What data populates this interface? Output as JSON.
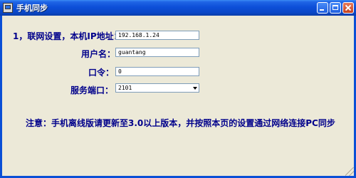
{
  "window": {
    "title": "手机同步"
  },
  "form": {
    "step_label": "1，联网设置，本机IP地址：",
    "ip_value": "192.168.1.24",
    "username_label": "用户名：",
    "username_value": "guantang",
    "password_label": "口令：",
    "password_value": "0",
    "port_label": "服务端口：",
    "port_value": "2101"
  },
  "notice": "注意：手机离线版请更新至3.0以上版本，并按照本页的设置通过网络连接PC同步"
}
